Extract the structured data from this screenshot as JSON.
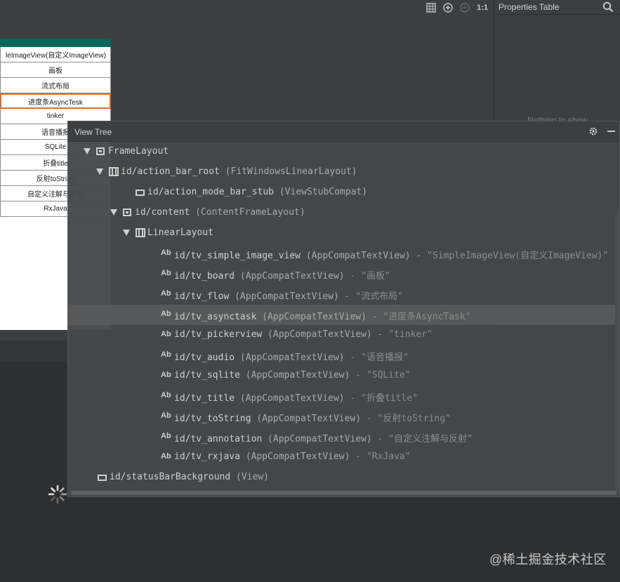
{
  "toolbar": {
    "zoom_ratio": "1:1",
    "icons": [
      "grid-icon",
      "zoom-in-icon",
      "zoom-out-icon"
    ]
  },
  "properties": {
    "title": "Properties Table",
    "empty_text": "Nothing to show"
  },
  "preview": {
    "items": [
      "leImageView(自定义ImageView)",
      "画板",
      "流式布局",
      "进度条AsyncTesk",
      "tinker",
      "语音播报",
      "SQLite",
      "折叠title",
      "反射toString",
      "自定义注解与反射",
      "RxJava"
    ],
    "selected_index": 3,
    "action_bar_color": "#00675b"
  },
  "view_tree": {
    "title": "View Tree",
    "rows": [
      {
        "id": "FrameLayout",
        "cls": "",
        "text": ""
      },
      {
        "id": "id/action_bar_root",
        "cls": " (FitWindowsLinearLayout)",
        "text": ""
      },
      {
        "id": "id/action_mode_bar_stub",
        "cls": " (ViewStubCompat)",
        "text": ""
      },
      {
        "id": "id/content",
        "cls": " (ContentFrameLayout)",
        "text": ""
      },
      {
        "id": "LinearLayout",
        "cls": "",
        "text": ""
      },
      {
        "id": "id/tv_simple_image_view",
        "cls": " (AppCompatTextView)",
        "text": " - \"SimpleImageView(自定义ImageView)\""
      },
      {
        "id": "id/tv_board",
        "cls": " (AppCompatTextView)",
        "text": " - \"画板\""
      },
      {
        "id": "id/tv_flow",
        "cls": " (AppCompatTextView)",
        "text": " - \"流式布局\""
      },
      {
        "id": "id/tv_asynctask",
        "cls": " (AppCompatTextView)",
        "text": " - \"进度条AsyncTask\""
      },
      {
        "id": "id/tv_pickerview",
        "cls": " (AppCompatTextView)",
        "text": " - \"tinker\""
      },
      {
        "id": "id/tv_audio",
        "cls": " (AppCompatTextView)",
        "text": " - \"语音播报\""
      },
      {
        "id": "id/tv_sqlite",
        "cls": " (AppCompatTextView)",
        "text": " - \"SQLite\""
      },
      {
        "id": "id/tv_title",
        "cls": " (AppCompatTextView)",
        "text": " - \"折叠title\""
      },
      {
        "id": "id/tv_toString",
        "cls": " (AppCompatTextView)",
        "text": " - \"反射toString\""
      },
      {
        "id": "id/tv_annotation",
        "cls": " (AppCompatTextView)",
        "text": " - \"自定义注解与反射\""
      },
      {
        "id": "id/tv_rxjava",
        "cls": " (AppCompatTextView)",
        "text": " - \"RxJava\""
      },
      {
        "id": "id/statusBarBackground",
        "cls": " (View)",
        "text": ""
      }
    ],
    "selected_row": 8
  },
  "watermark": "@稀土掘金技术社区"
}
